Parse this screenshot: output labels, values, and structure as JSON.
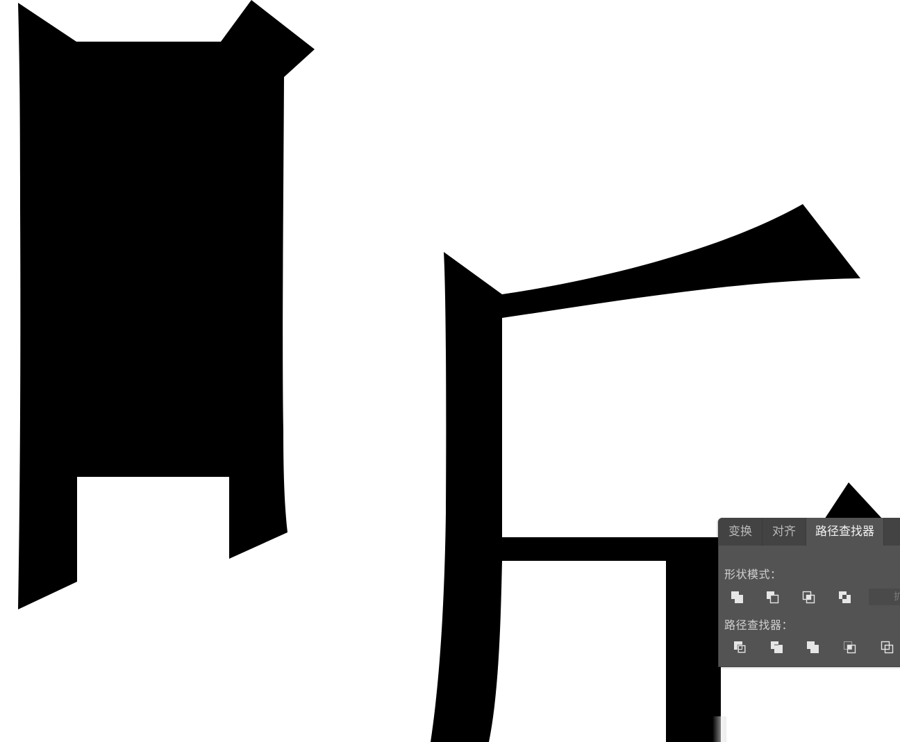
{
  "panel": {
    "tabs": [
      {
        "label": "变换",
        "active": false
      },
      {
        "label": "对齐",
        "active": false
      },
      {
        "label": "路径查找器",
        "active": true
      }
    ],
    "shape_modes_label": "形状模式：",
    "pathfinders_label": "路径查找器：",
    "expand_label": "扩展",
    "shape_mode_buttons": [
      "unite-icon",
      "minus-front-icon",
      "intersect-icon",
      "exclude-icon"
    ],
    "pathfinder_buttons": [
      "divide-icon",
      "trim-icon",
      "merge-icon",
      "crop-icon",
      "outline-icon"
    ]
  },
  "colors": {
    "artwork_fill": "#000000",
    "canvas_background": "#ffffff",
    "panel_background": "#535353",
    "tabbar_background": "#434343",
    "panel_text": "#d6d6d6"
  }
}
